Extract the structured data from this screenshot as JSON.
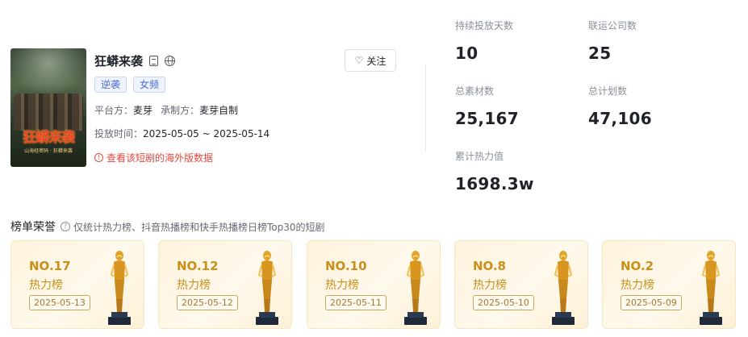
{
  "drama": {
    "title": "狂蟒来袭",
    "poster_title": "狂蟒来袭",
    "poster_subtitle": "山海经密码 · 狂蟒来袭",
    "tags": [
      "逆袭",
      "女频"
    ],
    "platform_label": "平台方：",
    "platform": "麦芽",
    "producer_label": "承制方：",
    "producer": "麦芽自制",
    "airtime_label": "投放时间：",
    "airtime": "2025-05-05 ~ 2025-05-14",
    "overseas_link": "查看该短剧的海外版数据",
    "follow_label": "关注"
  },
  "stats": [
    {
      "label": "持续投放天数",
      "value": "10"
    },
    {
      "label": "联运公司数",
      "value": "25"
    },
    {
      "label": "总素材数",
      "value": "25,167"
    },
    {
      "label": "总计划数",
      "value": "47,106"
    },
    {
      "label": "累计热力值",
      "value": "1698.3w"
    }
  ],
  "honors": {
    "title": "榜单荣誉",
    "note": "仅统计热力榜、抖音热播榜和快手热播榜日榜Top30的短剧",
    "cards": [
      {
        "rank": "NO.17",
        "list": "热力榜",
        "date": "2025-05-13"
      },
      {
        "rank": "NO.12",
        "list": "热力榜",
        "date": "2025-05-12"
      },
      {
        "rank": "NO.10",
        "list": "热力榜",
        "date": "2025-05-11"
      },
      {
        "rank": "NO.8",
        "list": "热力榜",
        "date": "2025-05-10"
      },
      {
        "rank": "NO.2",
        "list": "热力榜",
        "date": "2025-05-09"
      }
    ]
  },
  "colors": {
    "accent_red": "#e5483d",
    "tag_blue": "#4c6ccf",
    "gold": "#c8901a"
  }
}
